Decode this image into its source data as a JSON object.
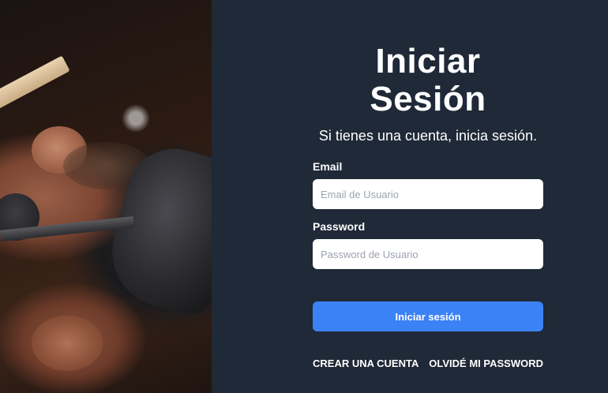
{
  "login": {
    "title_line1": "Iniciar",
    "title_line2": "Sesión",
    "subtitle": "Si tienes una cuenta, inicia sesión.",
    "email_label": "Email",
    "email_placeholder": "Email de Usuario",
    "email_value": "",
    "password_label": "Password",
    "password_placeholder": "Password de Usuario",
    "password_value": "",
    "submit_label": "Iniciar sesión",
    "create_account_link": "CREAR UNA CUENTA",
    "forgot_password_link": "OLVIDÉ MI PASSWORD"
  },
  "colors": {
    "panel_background": "#1f2937",
    "primary_button": "#3b82f6",
    "text": "#ffffff"
  },
  "hero_image": {
    "subject": "barber-shaving-beard-photo"
  }
}
